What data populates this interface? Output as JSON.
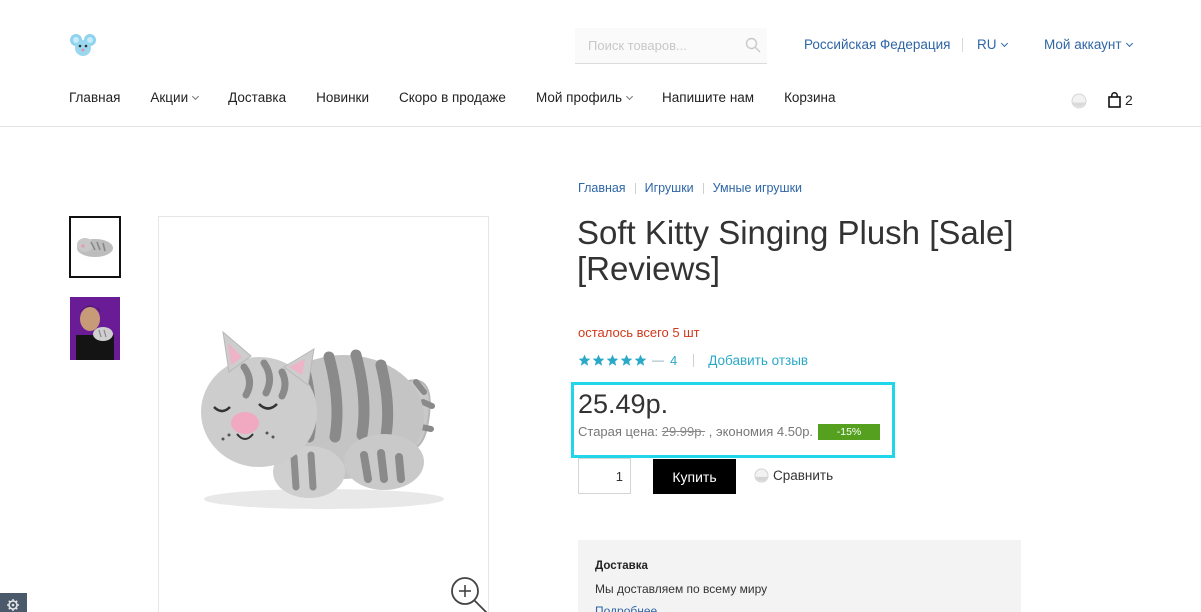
{
  "header": {
    "search_placeholder": "Поиск товаров...",
    "region": "Российская Федерация",
    "language": "RU",
    "account": "Мой аккаунт",
    "cart_count": "2"
  },
  "nav": {
    "items": [
      {
        "label": "Главная",
        "has_dropdown": false
      },
      {
        "label": "Акции",
        "has_dropdown": true
      },
      {
        "label": "Доставка",
        "has_dropdown": false
      },
      {
        "label": "Новинки",
        "has_dropdown": false
      },
      {
        "label": "Скоро в продаже",
        "has_dropdown": false
      },
      {
        "label": "Мой профиль",
        "has_dropdown": true
      },
      {
        "label": "Напишите нам",
        "has_dropdown": false
      },
      {
        "label": "Корзина",
        "has_dropdown": false
      }
    ]
  },
  "breadcrumb": [
    "Главная",
    "Игрушки",
    "Умные игрушки"
  ],
  "product": {
    "title": "Soft Kitty Singing Plush [Sale] [Reviews]",
    "stock": "осталось всего 5 шт",
    "rating_stars": 5,
    "reviews_count": "4",
    "add_review": "Добавить отзыв",
    "price": "25.49р.",
    "old_price_label": "Старая цена:",
    "old_price": "29.99р.",
    "saving": ", экономия 4.50р.",
    "discount": "-15%",
    "quantity": "1",
    "buy_label": "Купить",
    "compare_label": "Сравнить"
  },
  "delivery": {
    "heading": "Доставка",
    "text": "Мы доставляем по всему миру",
    "more": "Подробнее"
  },
  "colors": {
    "link": "#2e66a6",
    "accent_teal": "#2aa8c8",
    "stock_red": "#d0391b",
    "discount_green": "#55a11f",
    "highlight_cyan": "#22d6ea"
  }
}
